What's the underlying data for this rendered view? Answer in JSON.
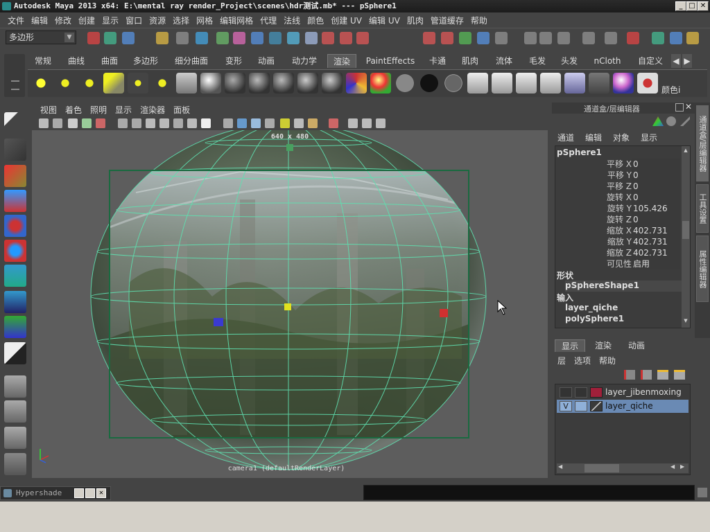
{
  "window": {
    "title": "Autodesk Maya 2013 x64: E:\\mental ray render_Project\\scenes\\hdr测试.mb*   ---   pSphere1",
    "min_label": "_",
    "max_label": "□",
    "close_label": "✕"
  },
  "menubar": [
    "文件",
    "编辑",
    "修改",
    "创建",
    "显示",
    "窗口",
    "资源",
    "选择",
    "网格",
    "编辑网格",
    "代理",
    "法线",
    "颜色",
    "创建 UV",
    "编辑 UV",
    "肌肉",
    "管道缓存",
    "帮助"
  ],
  "mode_selector": {
    "value": "多边形",
    "arrow": "▼"
  },
  "shelf_tabs": {
    "items": [
      "常规",
      "曲线",
      "曲面",
      "多边形",
      "细分曲面",
      "变形",
      "动画",
      "动力学",
      "渲染",
      "PaintEffects",
      "卡通",
      "肌肉",
      "流体",
      "毛发",
      "头发",
      "nCloth",
      "自定义"
    ],
    "active": "渲染",
    "scroll_left": "◀",
    "scroll_right": "▶"
  },
  "shelf_last_label": "颜色i",
  "viewport": {
    "menu": [
      "视图",
      "着色",
      "照明",
      "显示",
      "渲染器",
      "面板"
    ],
    "resolution_label": "640 x 480",
    "camera_label": "camera1 (defaultRenderLayer)",
    "colors": {
      "background": "#5d5d5d",
      "wireframe": "#5fe0b0",
      "gate": "#1a6a40"
    }
  },
  "channel_box": {
    "header": "通道盒/层编辑器",
    "menu": [
      "通道",
      "编辑",
      "对象",
      "显示"
    ],
    "object_name": "pSphere1",
    "attributes": [
      {
        "label": "平移 X",
        "value": "0"
      },
      {
        "label": "平移 Y",
        "value": "0"
      },
      {
        "label": "平移 Z",
        "value": "0"
      },
      {
        "label": "旋转 X",
        "value": "0"
      },
      {
        "label": "旋转 Y",
        "value": "105.426"
      },
      {
        "label": "旋转 Z",
        "value": "0"
      },
      {
        "label": "缩放 X",
        "value": "402.731"
      },
      {
        "label": "缩放 Y",
        "value": "402.731"
      },
      {
        "label": "缩放 Z",
        "value": "402.731"
      },
      {
        "label": "可见性",
        "value": "启用"
      }
    ],
    "shapes_header": "形状",
    "shape_name": "pSphereShape1",
    "inputs_header": "输入",
    "inputs": [
      "layer_qiche",
      "polySphere1"
    ]
  },
  "layer_editor": {
    "tabs": [
      "显示",
      "渲染",
      "动画"
    ],
    "active_tab": "显示",
    "menu": [
      "层",
      "选项",
      "帮助"
    ],
    "layers": [
      {
        "visible": "",
        "name": "layer_jibenmoxing",
        "color": "#a0203a"
      },
      {
        "visible": "V",
        "name": "layer_qiche",
        "color": "#3a3a3a"
      }
    ]
  },
  "side_tabs": [
    "通道盒/层编辑器",
    "工具设置",
    "属性编辑器"
  ],
  "bottom": {
    "hypershade_label": "Hypershade"
  }
}
